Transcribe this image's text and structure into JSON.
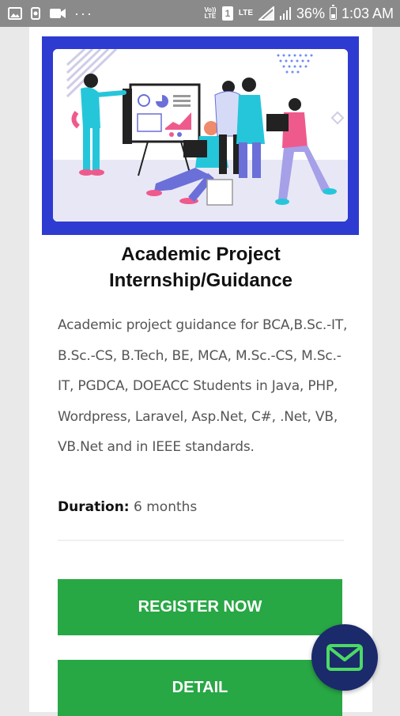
{
  "status_bar": {
    "network_label_1": "Vo)) LTE",
    "sim_label": "1",
    "network_label_2": "LTE",
    "battery_percent": "36%",
    "time": "1:03 AM"
  },
  "course": {
    "title": "Academic Project Internship/Guidance",
    "description": "Academic project guidance for BCA,B.Sc.-IT, B.Sc.-CS, B.Tech, BE, MCA, M.Sc.-CS, M.Sc.-IT, PGDCA, DOEACC Students in Java, PHP, Wordpress, Laravel, Asp.Net, C#, .Net, VB, VB.Net and in IEEE standards.",
    "duration_label": "Duration:",
    "duration_value": "6 months"
  },
  "buttons": {
    "register": "REGISTER NOW",
    "detail": "DETAIL"
  },
  "colors": {
    "hero_frame": "#2e3bd0",
    "button_green": "#28a745",
    "fab_navy": "#1b2a6b",
    "fab_icon": "#4cd964"
  },
  "icons": {
    "status_left": [
      "image-icon",
      "settings-icon",
      "video-icon",
      "more-icon"
    ],
    "fab": "mail-icon"
  }
}
